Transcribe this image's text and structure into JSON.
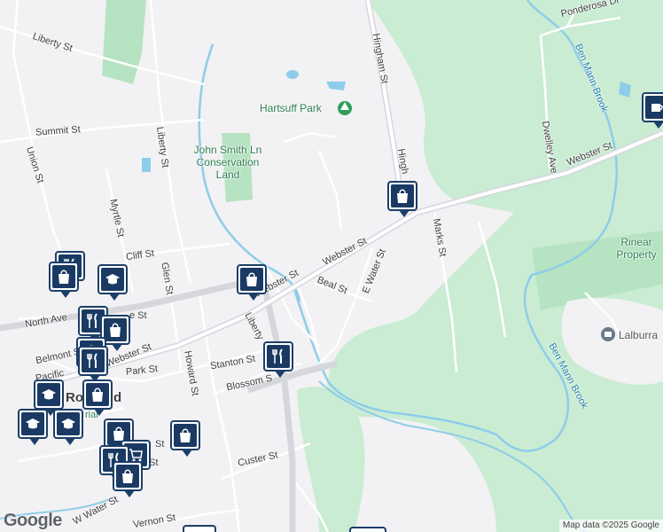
{
  "map": {
    "streets": {
      "liberty_st_nw": "Liberty St",
      "union_st": "Union St",
      "summit_st": "Summit St",
      "liberty_st_mid": "Liberty St",
      "myrtle_st": "Myrtle St",
      "cliff_st": "Cliff St",
      "glen_st": "Glen St",
      "north_ave": "North Ave",
      "belmont_st": "Belmont S",
      "webster_st_w": "Webster St",
      "webster_st_mid": "Webster St",
      "webster_st_ne": "Webster St",
      "beal_st": "Beal St",
      "e_water_st": "E Water St",
      "marks_st": "Marks St",
      "hingham_st": "Hingham St",
      "hingham_st_2": "Hingh",
      "liberty_st_s": "Liberty",
      "park_st": "Park St",
      "howard_st": "Howard St",
      "stanton_st": "Stanton St",
      "blossom_st": "Blossom S",
      "custer_st": "Custer St",
      "vernon_st": "Vernon St",
      "w_water_st": "W Water St",
      "ponderosa_dr": "Ponderosa Dr",
      "dwelley_ave": "Dwelley Ave",
      "st_fragment": "St",
      "pacific": "Pacific",
      "e_st": "e St",
      "t_st": "t St",
      "rockland_partial": "Ro",
      "d_partial": "d",
      "rial_partial": "rial",
      "m_partial": "m"
    },
    "places": {
      "hartsuff_park": "Hartsuff Park",
      "conservation_land": "John Smith Ln Conservation Land",
      "rinear_property": "Rinear Property",
      "lalburra": "Lalburra"
    },
    "water": {
      "ben_mann_brook_n": "Ben Mann Brook",
      "ben_mann_brook_s": "Ben Mann Brook"
    },
    "attribution": "Map data ©2025 Google",
    "logo": "Google",
    "colors": {
      "background": "#f2f1f3",
      "green": "#c9ecd3",
      "green_dark": "#b6e3c2",
      "water": "#8ecde9",
      "road": "#ffffff",
      "major_road": "#d5d7dd",
      "pin_fill": "#1a3a63"
    },
    "pins": [
      {
        "id": "shop-hingham",
        "icon": "shopping-bag-icon"
      },
      {
        "id": "shop-webster",
        "icon": "shopping-bag-icon"
      },
      {
        "id": "restaurant-blossom",
        "icon": "fork-knife-icon"
      },
      {
        "id": "shop-custer",
        "icon": "shopping-bag-icon"
      },
      {
        "id": "cafe-ne",
        "icon": "coffee-cup-icon"
      },
      {
        "id": "school-1",
        "icon": "graduation-cap-icon"
      },
      {
        "id": "school-2",
        "icon": "graduation-cap-icon"
      },
      {
        "id": "school-3",
        "icon": "graduation-cap-icon"
      },
      {
        "id": "school-4",
        "icon": "graduation-cap-icon"
      },
      {
        "id": "shop-cluster-1",
        "icon": "shopping-bag-icon"
      },
      {
        "id": "shop-cluster-2",
        "icon": "shopping-bag-icon"
      },
      {
        "id": "shop-cluster-3",
        "icon": "shopping-bag-icon"
      },
      {
        "id": "shop-cluster-4",
        "icon": "shopping-bag-icon"
      },
      {
        "id": "restaurant-cluster-1",
        "icon": "fork-knife-icon"
      },
      {
        "id": "restaurant-cluster-2",
        "icon": "fork-knife-icon"
      },
      {
        "id": "restaurant-cluster-3",
        "icon": "fork-knife-icon"
      },
      {
        "id": "grocery-cluster",
        "icon": "shopping-cart-icon"
      }
    ]
  }
}
